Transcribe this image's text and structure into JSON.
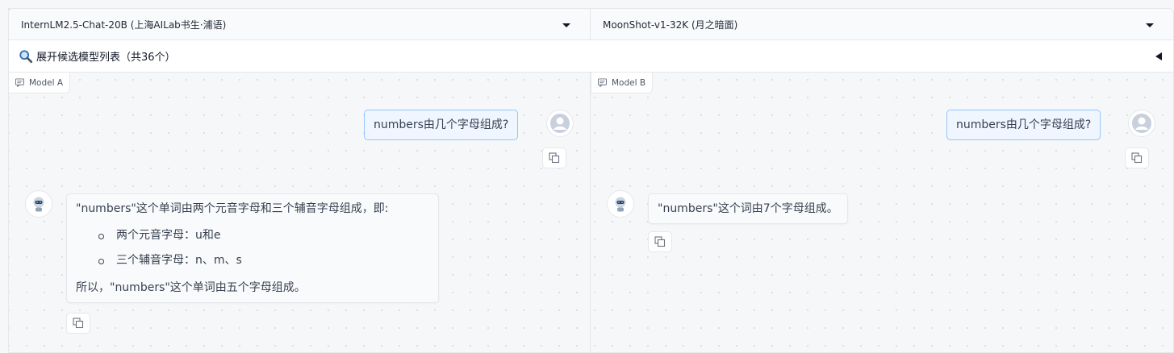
{
  "selectors": {
    "model_a": "InternLM2.5-Chat-20B (上海AILab书生·浦语)",
    "model_b": "MoonShot-v1-32K (月之暗面)"
  },
  "expander": {
    "icon": "search-icon",
    "label": "展开候选模型列表（共36个）"
  },
  "panels": {
    "left": {
      "label": "Model A",
      "user_message": "numbers由几个字母组成?",
      "bot_message": {
        "intro": "\"numbers\"这个单词由两个元音字母和三个辅音字母组成，即:",
        "items": [
          "两个元音字母：u和e",
          "三个辅音字母：n、m、s"
        ],
        "conclusion": "所以，\"numbers\"这个单词由五个字母组成。"
      }
    },
    "right": {
      "label": "Model B",
      "user_message": "numbers由几个字母组成?",
      "bot_message": "\"numbers\"这个词由7个字母组成。"
    }
  },
  "colors": {
    "user_bubble_bg": "#eff6ff",
    "user_bubble_border": "#93c5fd",
    "bot_bubble_bg": "#f9fafb",
    "panel_border": "#e5e7eb"
  }
}
